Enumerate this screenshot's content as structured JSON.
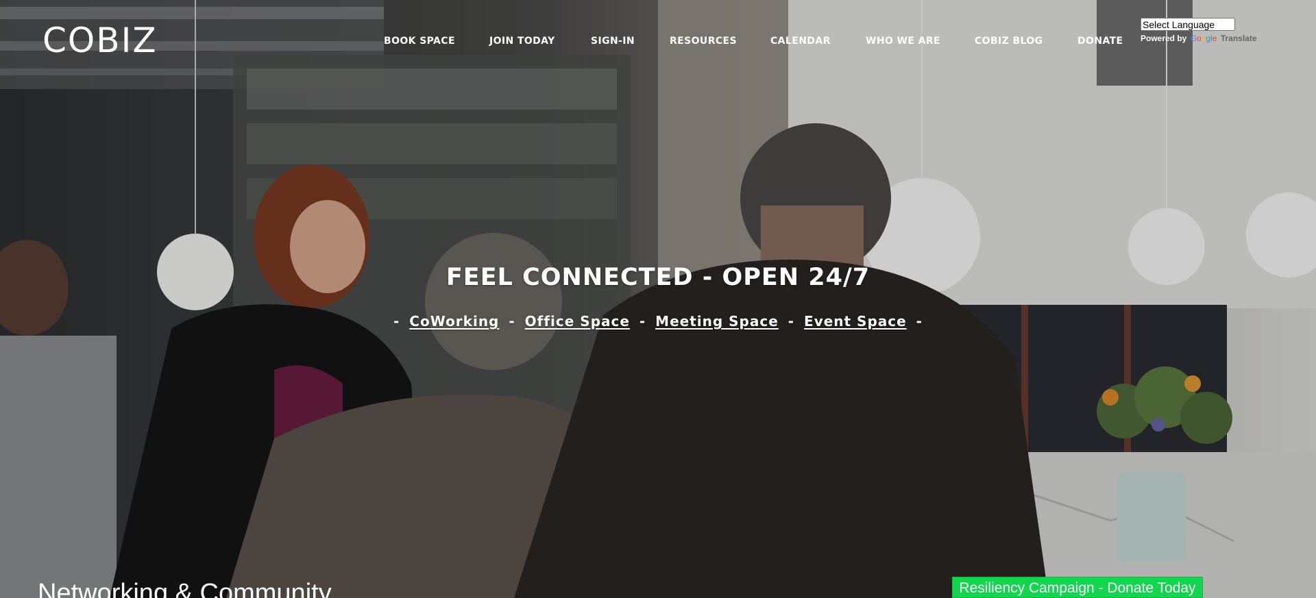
{
  "brand": {
    "logo_text": "COBIZ"
  },
  "nav": {
    "items": [
      {
        "label": "BOOK SPACE"
      },
      {
        "label": "JOIN TODAY"
      },
      {
        "label": "SIGN-IN"
      },
      {
        "label": "RESOURCES"
      },
      {
        "label": "CALENDAR"
      },
      {
        "label": "WHO WE ARE"
      },
      {
        "label": "COBIZ BLOG"
      },
      {
        "label": "DONATE"
      }
    ]
  },
  "translate": {
    "selected_value": "Select Language",
    "powered_by": "Powered by",
    "google_logo": "Google",
    "translate_label": "Translate"
  },
  "hero": {
    "headline": "FEEL CONNECTED - OPEN 24/7",
    "separator": "-",
    "services": [
      {
        "label": "CoWorking"
      },
      {
        "label": "Office Space"
      },
      {
        "label": "Meeting Space"
      },
      {
        "label": "Event Space"
      }
    ]
  },
  "section_heading": "Networking & Community",
  "donate_bar": {
    "label": "Resiliency Campaign - Donate Today",
    "color": "#12d64d"
  },
  "colors": {
    "nav_text": "#ffffff",
    "hero_text": "#ffffff"
  }
}
